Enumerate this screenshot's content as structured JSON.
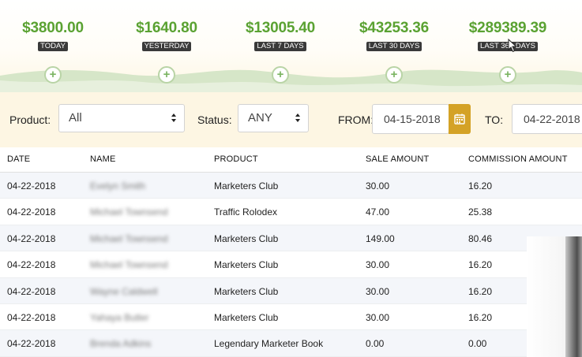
{
  "stats": [
    {
      "amount": "$3800.00",
      "label": "TODAY"
    },
    {
      "amount": "$1640.80",
      "label": "YESTERDAY"
    },
    {
      "amount": "$13005.40",
      "label": "LAST 7 DAYS"
    },
    {
      "amount": "$43253.36",
      "label": "LAST 30 DAYS"
    },
    {
      "amount": "$289389.39",
      "label": "LAST 365 DAYS"
    }
  ],
  "filters": {
    "product_label": "Product:",
    "product_value": "All",
    "status_label": "Status:",
    "status_value": "ANY",
    "from_label": "FROM:",
    "from_value": "04-15-2018",
    "to_label": "TO:",
    "to_value": "04-22-2018"
  },
  "table": {
    "columns": [
      "DATE",
      "NAME",
      "PRODUCT",
      "SALE AMOUNT",
      "COMMISSION AMOUNT"
    ],
    "rows": [
      {
        "date": "04-22-2018",
        "name": "Evelyn Smith",
        "product": "Marketers Club",
        "sale": "30.00",
        "commission": "16.20"
      },
      {
        "date": "04-22-2018",
        "name": "Michael Townsend",
        "product": "Traffic Rolodex",
        "sale": "47.00",
        "commission": "25.38"
      },
      {
        "date": "04-22-2018",
        "name": "Michael Townsend",
        "product": "Marketers Club",
        "sale": "149.00",
        "commission": "80.46"
      },
      {
        "date": "04-22-2018",
        "name": "Michael Townsend",
        "product": "Marketers Club",
        "sale": "30.00",
        "commission": "16.20"
      },
      {
        "date": "04-22-2018",
        "name": "Wayne Caldwell",
        "product": "Marketers Club",
        "sale": "30.00",
        "commission": "16.20"
      },
      {
        "date": "04-22-2018",
        "name": "Yahaya Butler",
        "product": "Marketers Club",
        "sale": "30.00",
        "commission": "16.20"
      },
      {
        "date": "04-22-2018",
        "name": "Brenda Adkins",
        "product": "Legendary Marketer Book",
        "sale": "0.00",
        "commission": "0.00"
      }
    ]
  },
  "colors": {
    "amount_green": "#5aa232",
    "calendar_gold": "#d4a226",
    "filter_bg": "#fdf6e3"
  },
  "icons": {
    "expand": "plus-circle-icon",
    "calendar": "calendar-icon",
    "select": "sort-caret-icon"
  }
}
